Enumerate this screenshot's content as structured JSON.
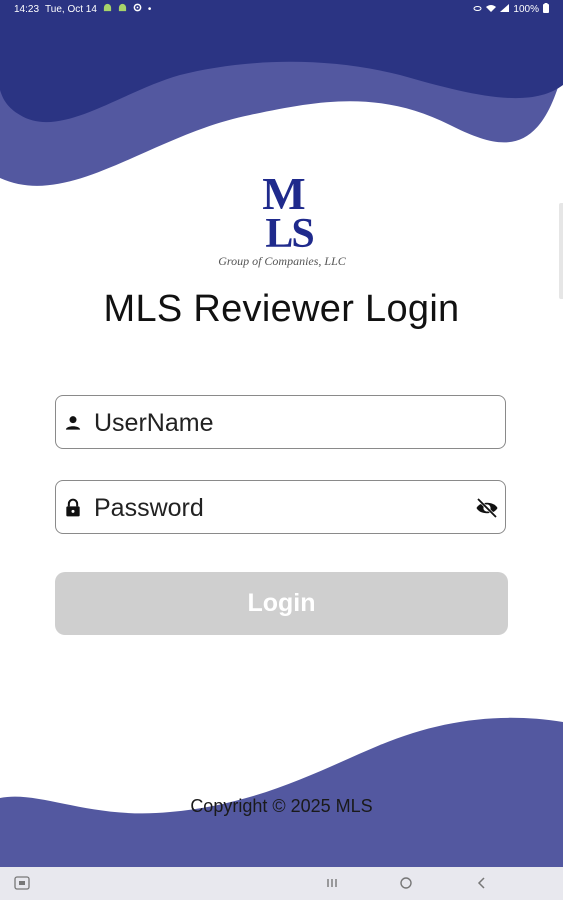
{
  "status": {
    "time": "14:23",
    "date": "Tue, Oct 14",
    "battery": "100%"
  },
  "logo": {
    "mark": "MLS",
    "tagline": "Group of Companies, LLC",
    "color": "#1f2a8c"
  },
  "title": "MLS Reviewer Login",
  "form": {
    "username_placeholder": "UserName",
    "password_placeholder": "Password",
    "login_label": "Login"
  },
  "footer": {
    "copyright": "Copyright © 2025 MLS"
  },
  "theme": {
    "wave_dark": "#2b3483",
    "wave_light": "#5358a0",
    "button_disabled": "#cfcfcf"
  },
  "icons": {
    "user": "person-icon",
    "lock": "lock-icon",
    "visibility": "eye-off-icon"
  }
}
